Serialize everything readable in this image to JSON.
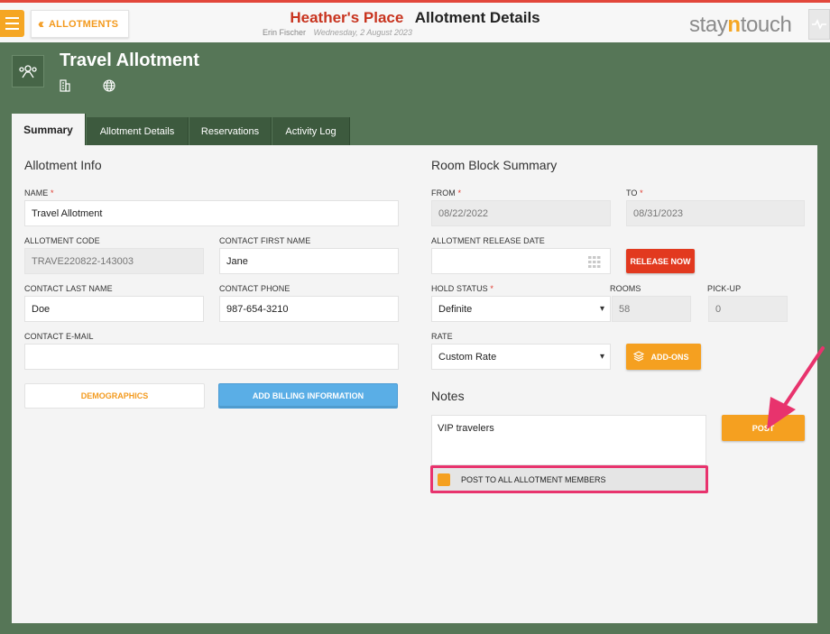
{
  "header": {
    "back_label": "ALLOTMENTS",
    "hotel_name": "Heather's Place",
    "page_name": "Allotment Details",
    "user": "Erin Fischer",
    "date": "Wednesday, 2 August 2023",
    "logo_a": "stay",
    "logo_b": "n",
    "logo_c": "touch"
  },
  "page": {
    "title": "Travel Allotment"
  },
  "tabs": [
    "Summary",
    "Allotment Details",
    "Reservations",
    "Activity Log"
  ],
  "allotment_info": {
    "heading": "Allotment Info",
    "name_label": "NAME",
    "name_value": "Travel Allotment",
    "code_label": "ALLOTMENT CODE",
    "code_value": "TRAVE220822-143003",
    "first_name_label": "CONTACT FIRST NAME",
    "first_name_value": "Jane",
    "last_name_label": "CONTACT LAST NAME",
    "last_name_value": "Doe",
    "phone_label": "CONTACT PHONE",
    "phone_value": "987-654-3210",
    "email_label": "CONTACT E-MAIL",
    "email_value": "",
    "demographics_button": "DEMOGRAPHICS",
    "billing_button": "ADD BILLING INFORMATION"
  },
  "room_block": {
    "heading": "Room Block Summary",
    "from_label": "FROM",
    "from_value": "08/22/2022",
    "to_label": "TO",
    "to_value": "08/31/2023",
    "release_label": "ALLOTMENT RELEASE DATE",
    "release_value": "",
    "release_button": "RELEASE NOW",
    "hold_label": "HOLD STATUS",
    "hold_value": "Definite",
    "rooms_label": "ROOMS",
    "rooms_value": "58",
    "pickup_label": "PICK-UP",
    "pickup_value": "0",
    "rate_label": "RATE",
    "rate_value": "Custom Rate",
    "addons_button": "ADD-ONS"
  },
  "notes": {
    "heading": "Notes",
    "text": "VIP travelers",
    "post_button": "POST",
    "post_all_label": "POST TO ALL ALLOTMENT MEMBERS",
    "post_all_checked": true
  },
  "colors": {
    "brand_orange": "#f5a623",
    "hotel_red": "#c8341f",
    "background_green": "#567657",
    "annotation_pink": "#e8336d"
  }
}
